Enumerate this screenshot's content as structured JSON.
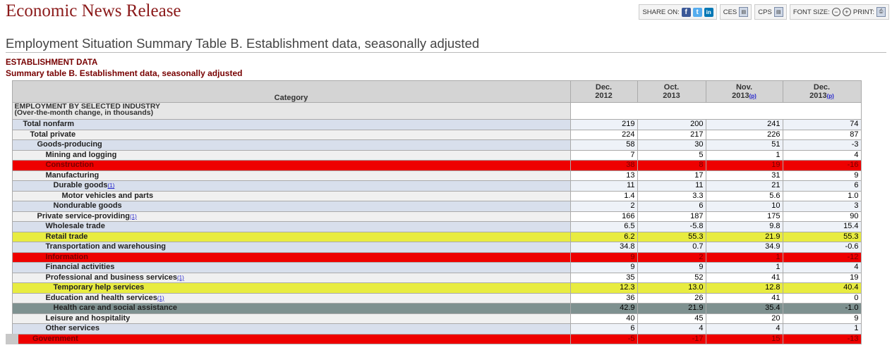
{
  "brand": "Economic News Release",
  "toolbar": {
    "share_label": "SHARE ON:",
    "ces_label": "CES",
    "cps_label": "CPS",
    "font_size_label": "FONT SIZE:",
    "print_label": "PRINT:"
  },
  "headline": "Employment Situation Summary Table B. Establishment data, seasonally adjusted",
  "section_title": "ESTABLISHMENT DATA",
  "section_subtitle": "Summary table B. Establishment data, seasonally adjusted",
  "table": {
    "category_header": "Category",
    "columns": [
      {
        "line1": "Dec.",
        "line2": "2012",
        "note": ""
      },
      {
        "line1": "Oct.",
        "line2": "2013",
        "note": ""
      },
      {
        "line1": "Nov.",
        "line2": "2013",
        "note": "(p)"
      },
      {
        "line1": "Dec.",
        "line2": "2013",
        "note": "(p)"
      }
    ],
    "group_label_1": "EMPLOYMENT BY SELECTED INDUSTRY",
    "group_label_2": "(Over-the-month change, in thousands)",
    "rows": [
      {
        "label": "Total nonfarm",
        "values": [
          "219",
          "200",
          "241",
          "74"
        ]
      },
      {
        "label": "Total private",
        "values": [
          "224",
          "217",
          "226",
          "87"
        ]
      },
      {
        "label": "Goods-producing",
        "values": [
          "58",
          "30",
          "51",
          "-3"
        ]
      },
      {
        "label": "Mining and logging",
        "values": [
          "7",
          "5",
          "1",
          "4"
        ]
      },
      {
        "label": "Construction",
        "values": [
          "38",
          "8",
          "19",
          "-16"
        ]
      },
      {
        "label": "Manufacturing",
        "values": [
          "13",
          "17",
          "31",
          "9"
        ]
      },
      {
        "label": "Durable goods",
        "note": "(1)",
        "values": [
          "11",
          "11",
          "21",
          "6"
        ]
      },
      {
        "label": "Motor vehicles and parts",
        "values": [
          "1.4",
          "3.3",
          "5.6",
          "1.0"
        ]
      },
      {
        "label": "Nondurable goods",
        "values": [
          "2",
          "6",
          "10",
          "3"
        ]
      },
      {
        "label": "Private service-providing",
        "note": "(1)",
        "values": [
          "166",
          "187",
          "175",
          "90"
        ]
      },
      {
        "label": "Wholesale trade",
        "values": [
          "6.5",
          "-5.8",
          "9.8",
          "15.4"
        ]
      },
      {
        "label": "Retail trade",
        "values": [
          "6.2",
          "55.3",
          "21.9",
          "55.3"
        ]
      },
      {
        "label": "Transportation and warehousing",
        "values": [
          "34.8",
          "0.7",
          "34.9",
          "-0.6"
        ]
      },
      {
        "label": "Information",
        "values": [
          "9",
          "2",
          "1",
          "-12"
        ]
      },
      {
        "label": "Financial activities",
        "values": [
          "9",
          "9",
          "1",
          "4"
        ]
      },
      {
        "label": "Professional and business services",
        "note": "(1)",
        "values": [
          "35",
          "52",
          "41",
          "19"
        ]
      },
      {
        "label": "Temporary help services",
        "values": [
          "12.3",
          "13.0",
          "12.8",
          "40.4"
        ]
      },
      {
        "label": "Education and health services",
        "note": "(1)",
        "values": [
          "36",
          "26",
          "41",
          "0"
        ]
      },
      {
        "label": "Health care and social assistance",
        "values": [
          "42.9",
          "21.9",
          "35.4",
          "-1.0"
        ]
      },
      {
        "label": "Leisure and hospitality",
        "values": [
          "40",
          "45",
          "20",
          "9"
        ]
      },
      {
        "label": "Other services",
        "values": [
          "6",
          "4",
          "4",
          "1"
        ]
      },
      {
        "label": "Government",
        "values": [
          "-5",
          "-17",
          "15",
          "-13"
        ]
      }
    ]
  }
}
